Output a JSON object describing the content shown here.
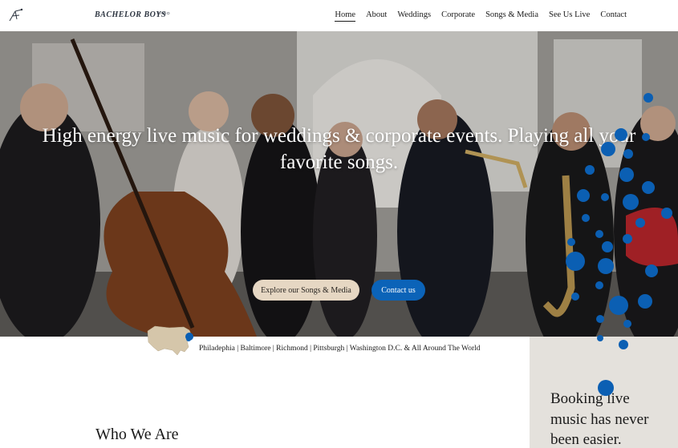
{
  "header": {
    "brand": "BACHELOR BOYS",
    "brand_sub": "BAND",
    "nav": [
      "Home",
      "About",
      "Weddings",
      "Corporate",
      "Songs & Media",
      "See Us Live",
      "Contact"
    ],
    "active_nav": "Home"
  },
  "hero": {
    "title": "High energy live music for weddings & corporate events. Playing all your favorite songs.",
    "explore_label": "Explore our Songs & Media",
    "contact_label": "Contact us"
  },
  "locations": {
    "text": "Philadephia | Baltimore | Richmond | Pittsburgh | Washington D.C. & All Around The World"
  },
  "about": {
    "heading": "Who We Are"
  },
  "booking": {
    "text": "Booking live music has never been easier."
  },
  "colors": {
    "accent_blue": "#0b63b8",
    "button_beige": "#e6d7c3",
    "panel_bg": "#e4e1dc"
  }
}
